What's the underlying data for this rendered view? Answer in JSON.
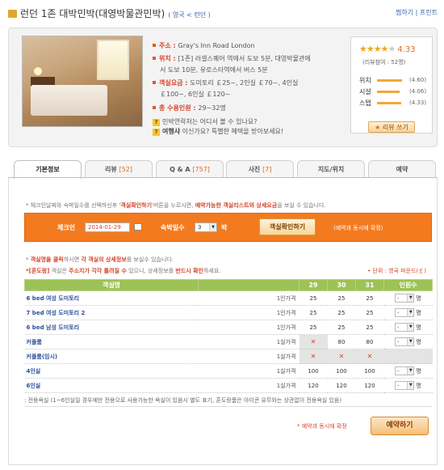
{
  "header": {
    "title": "런던 1존 대박민박(대영박물관민박)",
    "crumb_country": "영국",
    "crumb_city": "런던",
    "links": [
      "찜하기",
      "프린트"
    ]
  },
  "info": {
    "address_label": "주소",
    "address": "Gray's Inn Road London",
    "location_label": "위치",
    "location_line1": "[1존] 러셀스퀘어 역에서 도보 5분, 대영박물관에",
    "location_line2": "서 도보 10분, 유로스타역에서 버스 5분",
    "price_label": "객실요금",
    "price_line1": "도미토리 ￡25~, 2인실 ￡70~, 4인실",
    "price_line2": "￡100~, 6인실 ￡120~",
    "capacity_label": "총 수용인원",
    "capacity": "29~32명",
    "faq1": "민박연락처는 어디서 볼 수 있나요?",
    "faq2_label": "여행샤",
    "faq2": "이신가요? 특별한 혜택을 받아보세요!"
  },
  "review": {
    "score": "4.33",
    "stars_filled": 4,
    "count_text": "(리뷰참여 : 52명)",
    "criteria": [
      {
        "label": "위치",
        "value": "(4.60)",
        "level": 0.92
      },
      {
        "label": "시설",
        "value": "(4.06)",
        "level": 0.81
      },
      {
        "label": "스탭",
        "value": "(4.33)",
        "level": 0.87
      }
    ],
    "write_button": "리뷰 쓰기"
  },
  "tabs": [
    {
      "label": "기본정보",
      "count": ""
    },
    {
      "label": "리뷰",
      "count": "[52]"
    },
    {
      "label": "Q & A",
      "count": "[757]"
    },
    {
      "label": "사진",
      "count": "[7]"
    },
    {
      "label": "지도/위치",
      "count": ""
    },
    {
      "label": "예약",
      "count": ""
    }
  ],
  "booking": {
    "notice1_pre": "* 체크인날짜와 숙박일수를 선택하신후 '",
    "notice1_hl1": "객실확인하기",
    "notice1_mid": "'버튼을 누르시면, ",
    "notice1_hl2": "예약가능한 객실리스트와 상세요금",
    "notice1_post": "을 보실 수 있습니다.",
    "checkin_label": "체크인",
    "checkin_value": "2014-01-29",
    "nights_label": "숙박일수",
    "nights_value": "3",
    "nights_unit": "박",
    "check_button": "객실확인하기",
    "instant_note": "(예약과 동시에 확정)",
    "notice2_pre": "* ",
    "notice2_hl": "객실명을 클릭",
    "notice2_mid": "하시면 ",
    "notice2_hl2": "각 객실의 상세정보",
    "notice2_post": "를 보실수 있습니다.",
    "notice3_hl": "*[혼도랑]",
    "notice3_mid": " 객실은 ",
    "notice3_hl2": "주소지가 각각 틀려질 수",
    "notice3_mid2": " 있으니, 상세정보를 ",
    "notice3_hl3": "반드시 확인",
    "notice3_post": "하세요.",
    "unit_note": "• 단위 : 영국 파운드(￡)"
  },
  "table": {
    "headers": [
      "객실명",
      "",
      "29",
      "30",
      "31",
      "인원수"
    ],
    "rows": [
      {
        "name": "6 bed 여성 도미토리",
        "type": "1인가격",
        "d29": "25",
        "d30": "25",
        "d31": "25",
        "sel": "-",
        "x": [
          false,
          false,
          false
        ]
      },
      {
        "name": "7 bed 여성 도미토리 2",
        "type": "1인가격",
        "d29": "25",
        "d30": "25",
        "d31": "25",
        "sel": "-",
        "x": [
          false,
          false,
          false
        ]
      },
      {
        "name": "6 bed 남성 도미토리",
        "type": "1인가격",
        "d29": "25",
        "d30": "25",
        "d31": "25",
        "sel": "-",
        "x": [
          false,
          false,
          false
        ]
      },
      {
        "name": "커플룸",
        "type": "1실가격",
        "d29": "✕",
        "d30": "80",
        "d31": "80",
        "sel": "-",
        "x": [
          true,
          false,
          false
        ]
      },
      {
        "name": "커플룸(임시)",
        "type": "1실가격",
        "d29": "✕",
        "d30": "✕",
        "d31": "✕",
        "sel": "",
        "x": [
          true,
          true,
          true
        ]
      },
      {
        "name": "4인실",
        "type": "1실가격",
        "d29": "100",
        "d30": "100",
        "d31": "100",
        "sel": "-",
        "x": [
          false,
          false,
          false
        ]
      },
      {
        "name": "6인실",
        "type": "1실가격",
        "d29": "120",
        "d30": "120",
        "d31": "120",
        "sel": "-",
        "x": [
          false,
          false,
          false
        ]
      }
    ],
    "person_unit": "명",
    "legend": ": 전용욕실 (1~6인실일 경우에만 전용으로 사용가능한 욕실이 있음시 별도 표기, 혼도랑룸은 아이콘 유무와는 상관없이 전용욕실 있음)",
    "instant": "* 예약과 동시에 확정",
    "book_button": "예약하기"
  },
  "colors": {
    "accent": "#f47a1f",
    "header_green": "#9dc257",
    "link": "#2c4f9a",
    "alert": "#d3452a"
  }
}
